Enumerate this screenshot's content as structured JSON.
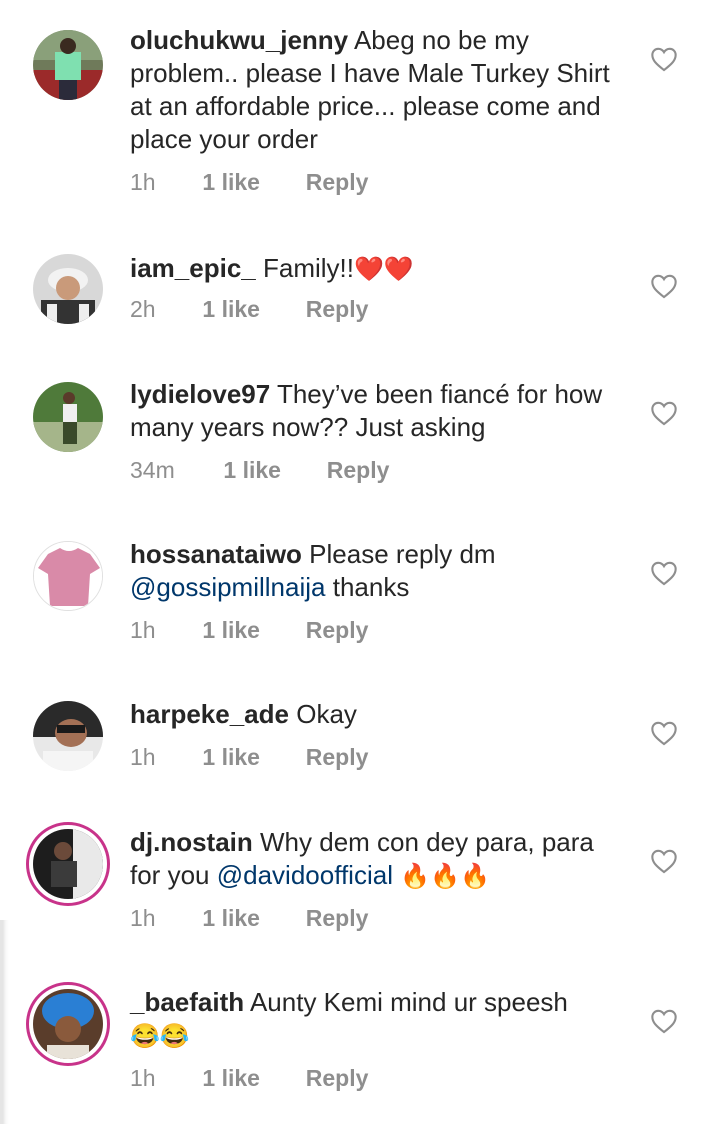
{
  "comments": [
    {
      "user": "oluchukwu_jenny",
      "text": "Abeg no be my problem.. please I have Male Turkey Shirt at an affordable price... please come and place your order",
      "time": "1h",
      "likes": "1 like",
      "reply": "Reply"
    },
    {
      "user": "iam_epic_",
      "text": "Family!!",
      "emoji": "❤️❤️",
      "time": "2h",
      "likes": "1 like",
      "reply": "Reply"
    },
    {
      "user": "lydielove97",
      "text": "They’ve been fiancé for how many years now?? Just asking",
      "time": "34m",
      "likes": "1 like",
      "reply": "Reply"
    },
    {
      "user": "hossanataiwo",
      "text": "Please reply dm",
      "mention": "@gossipmillnaija",
      "text_after": "thanks",
      "time": "1h",
      "likes": "1 like",
      "reply": "Reply"
    },
    {
      "user": "harpeke_ade",
      "text": "Okay",
      "time": "1h",
      "likes": "1 like",
      "reply": "Reply"
    },
    {
      "user": "dj.nostain",
      "text": "Why dem con dey para, para for you",
      "mention": "@davidoofficial",
      "emoji": "🔥🔥🔥",
      "time": "1h",
      "likes": "1 like",
      "reply": "Reply"
    },
    {
      "user": "_baefaith",
      "text": "Aunty Kemi mind ur speesh",
      "emoji": "😂😂",
      "time": "1h",
      "likes": "1 like",
      "reply": "Reply"
    }
  ],
  "icons": {
    "like": "heart-outline-icon"
  },
  "colors": {
    "text": "#262626",
    "meta": "#8e8e8e",
    "mention": "#00376b",
    "story_ring": "#c8338a"
  }
}
